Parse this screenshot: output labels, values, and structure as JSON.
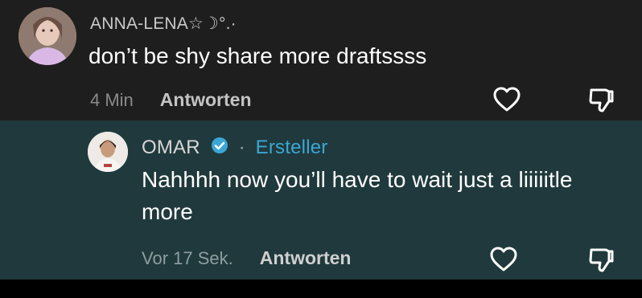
{
  "comments": [
    {
      "username": "ANNA-LENA☆☽°.·",
      "text": "don’t be shy share more draftssss",
      "time": "4 Min",
      "reply_label": "Antworten",
      "avatar": "woman-portrait-avatar"
    },
    {
      "username": "OMAR",
      "verified_icon": "verified-check-icon",
      "separator": "·",
      "role_badge": "Ersteller",
      "text": "Nahhhh now you’ll have to wait just a liiiiitle more",
      "time": "Vor 17 Sek.",
      "reply_label": "Antworten",
      "avatar": "man-portrait-avatar"
    }
  ],
  "icons": {
    "like": "heart-outline-icon",
    "dislike": "thumbs-down-outline-icon"
  },
  "colors": {
    "background": "#1e1e1e",
    "highlight_row": "#20393c",
    "creator_label": "#3aa7d6",
    "verified": "#3aa7d6"
  }
}
